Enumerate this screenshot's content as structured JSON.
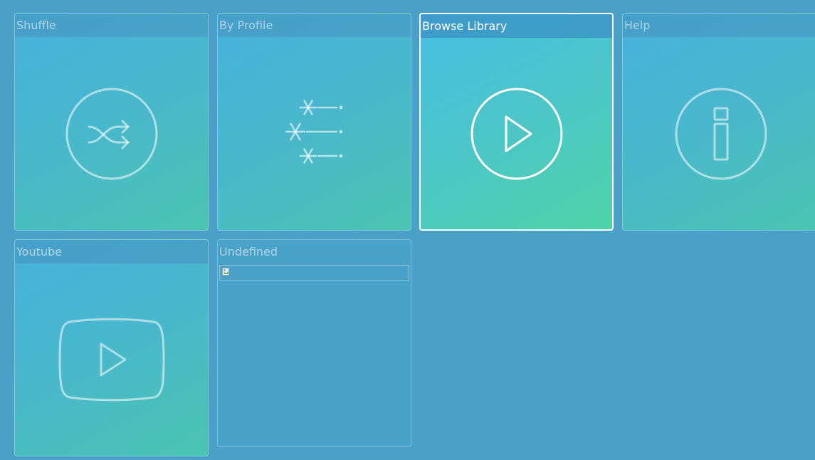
{
  "tiles": [
    {
      "label": "Shuffle",
      "icon": "shuffle-icon"
    },
    {
      "label": "By Profile",
      "icon": "snowflake-wind-icon"
    },
    {
      "label": "Browse Library",
      "icon": "play-circle-icon",
      "selected": true
    },
    {
      "label": "Help",
      "icon": "info-icon"
    },
    {
      "label": "Youtube",
      "icon": "youtube-icon"
    },
    {
      "label": "Undefined",
      "icon": "broken-image-icon"
    }
  ],
  "colors": {
    "background": "#4aa0c6",
    "tile_gradient_start": "#47b1dc",
    "tile_gradient_end": "#4cc5b0",
    "selected_border": "#ffffff"
  }
}
